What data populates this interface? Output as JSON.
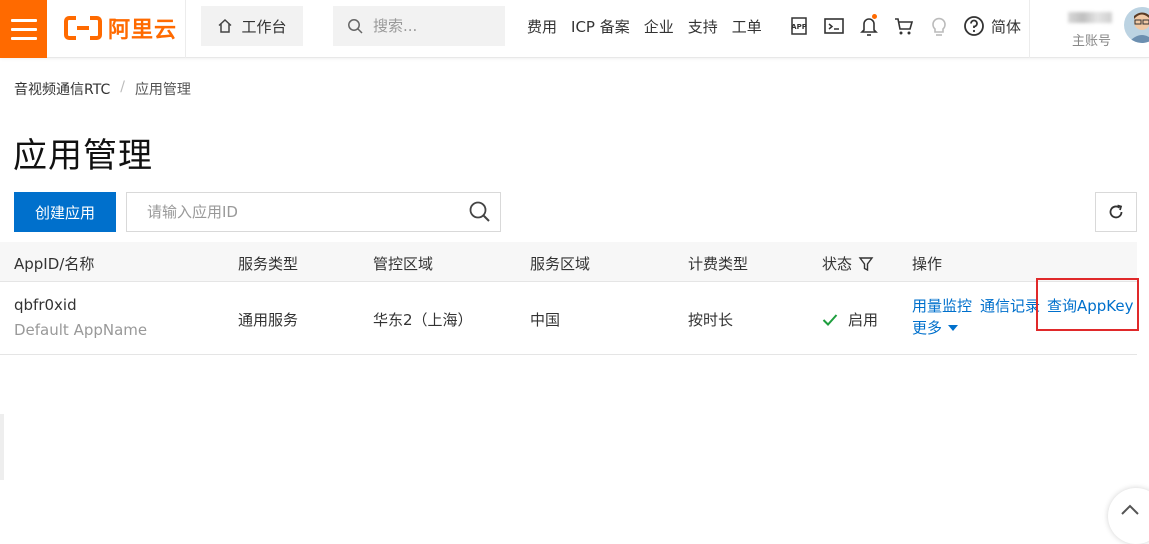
{
  "header": {
    "logo_text": "阿里云",
    "workbench_label": "工作台",
    "search_placeholder": "搜索...",
    "nav_links": [
      "费用",
      "ICP 备案",
      "企业",
      "支持",
      "工单"
    ],
    "icons": [
      "app-icon",
      "terminal-icon",
      "bell-icon",
      "cart-icon",
      "lightbulb-icon",
      "help-icon"
    ],
    "language": "简体",
    "account_label": "主账号",
    "accent_color": "#ff6a00"
  },
  "breadcrumb": {
    "parent": "音视频通信RTC",
    "separator": "/",
    "current": "应用管理"
  },
  "page": {
    "title": "应用管理"
  },
  "toolbar": {
    "create_label": "创建应用",
    "search_placeholder": "请输入应用ID",
    "primary_color": "#0070cc"
  },
  "table": {
    "headers": {
      "app": "AppID/名称",
      "service_type": "服务类型",
      "control_region": "管控区域",
      "service_region": "服务区域",
      "billing_type": "计费类型",
      "status": "状态",
      "actions": "操作"
    },
    "rows": [
      {
        "app_id": "qbfr0xid",
        "app_name": "Default AppName",
        "service_type": "通用服务",
        "control_region": "华东2（上海）",
        "service_region": "中国",
        "billing_type": "按时长",
        "status": "启用",
        "actions": {
          "usage": "用量监控",
          "records": "通信记录",
          "appkey": "查询AppKey",
          "more": "更多"
        }
      }
    ]
  }
}
